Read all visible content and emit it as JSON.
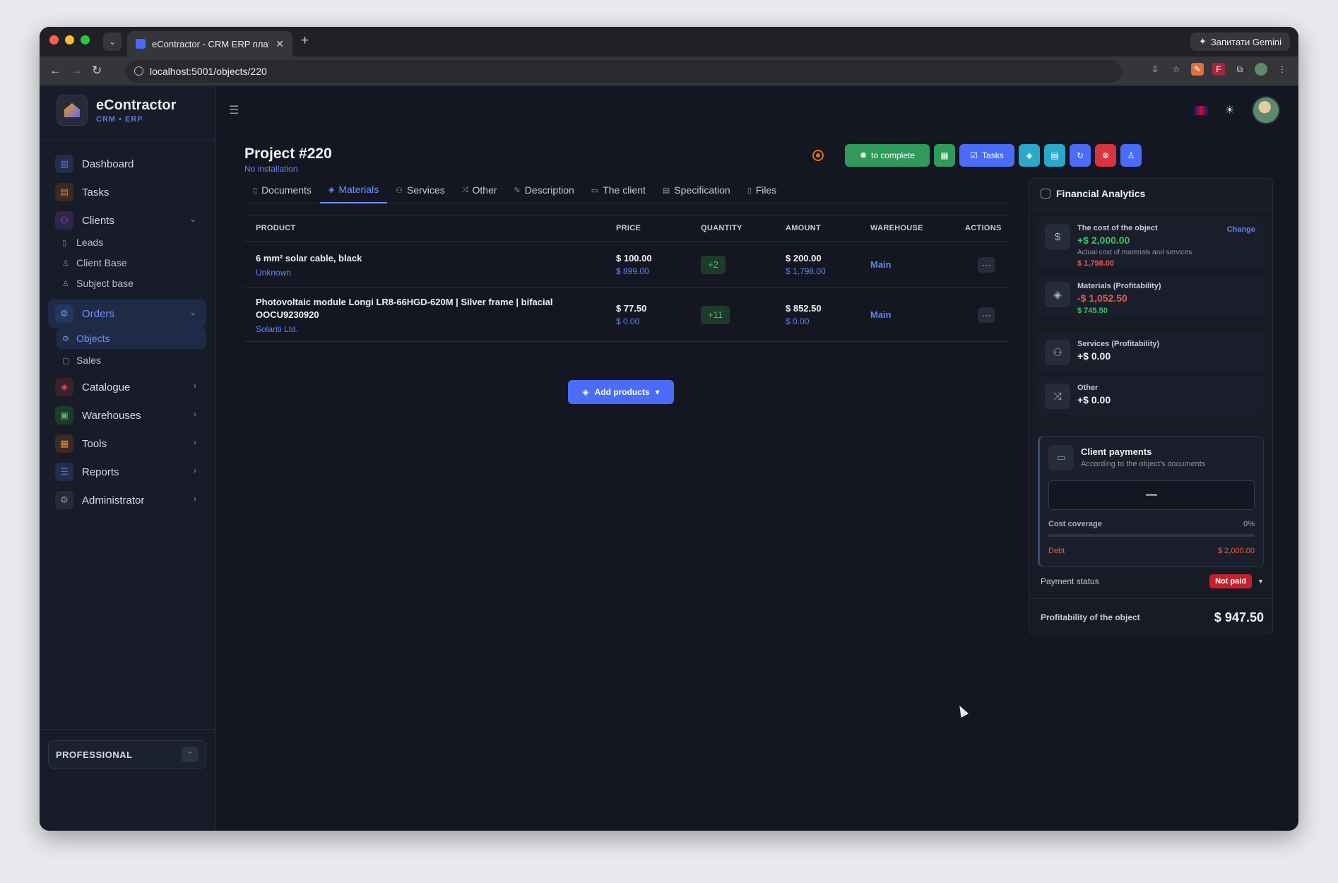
{
  "browser": {
    "tab_title": "eContractor - CRM ERP плат",
    "url": "localhost:5001/objects/220",
    "gemini_label": "Запитати Gemini"
  },
  "sidebar": {
    "brand_name": "eContractor",
    "brand_sub": "CRM • ERP",
    "items": [
      {
        "label": "Dashboard",
        "icon": "chart-bar-icon",
        "color": "#5b6ee0"
      },
      {
        "label": "Tasks",
        "icon": "clipboard-icon",
        "color": "#e0703a"
      },
      {
        "label": "Clients",
        "icon": "users-icon",
        "color": "#a05be0"
      },
      {
        "label": "Leads",
        "icon": "doc-icon"
      },
      {
        "label": "Client Base",
        "icon": "user-icon"
      },
      {
        "label": "Subject base",
        "icon": "user-icon"
      },
      {
        "label": "Orders",
        "icon": "gear-icon",
        "color": "#4a7ae0"
      },
      {
        "label": "Objects",
        "icon": "gear-icon"
      },
      {
        "label": "Sales",
        "icon": "bag-icon"
      },
      {
        "label": "Catalogue",
        "icon": "cube-icon",
        "color": "#e04a5b"
      },
      {
        "label": "Warehouses",
        "icon": "box-icon",
        "color": "#3fbf6a"
      },
      {
        "label": "Tools",
        "icon": "toolbox-icon",
        "color": "#e08a3a"
      },
      {
        "label": "Reports",
        "icon": "report-icon",
        "color": "#5b6ee0"
      },
      {
        "label": "Administrator",
        "icon": "gear-icon",
        "color": "#8b93a7"
      }
    ],
    "plan_label": "PROFESSIONAL"
  },
  "header": {
    "title": "Project #220",
    "subtitle": "No installation",
    "complete_label": "to complete",
    "tasks_label": "Tasks"
  },
  "tabs": [
    "Documents",
    "Materials",
    "Services",
    "Other",
    "Description",
    "The client",
    "Specification",
    "Files"
  ],
  "table": {
    "headers": [
      "PRODUCT",
      "PRICE",
      "QUANTITY",
      "AMOUNT",
      "WAREHOUSE",
      "ACTIONS"
    ],
    "rows": [
      {
        "product": "6 mm² solar cable, black",
        "supplier": "Unknown",
        "price": "$ 100.00",
        "price2": "$ 899.00",
        "qty": "+2",
        "amount": "$ 200.00",
        "amount2": "$ 1,798.00",
        "warehouse": "Main"
      },
      {
        "product": "Photovoltaic module Longi LR8-66HGD-620M | Silver frame | bifacial OOCU9230920",
        "supplier": "Solariti Ltd.",
        "price": "$ 77.50",
        "price2": "$ 0.00",
        "qty": "+11",
        "amount": "$ 852.50",
        "amount2": "$ 0.00",
        "warehouse": "Main"
      }
    ],
    "add_label": "Add products"
  },
  "finance": {
    "title": "Financial Analytics",
    "cost_label": "The cost of the object",
    "cost_value": "+$ 2,000.00",
    "cost_note": "Actual cost of materials and services",
    "cost_actual": "$ 1,798.00",
    "change_label": "Change",
    "materials_label": "Materials (Profitability)",
    "materials_value": "-$ 1,052.50",
    "materials_sub": "$ 745.50",
    "services_label": "Services (Profitability)",
    "services_value": "+$ 0.00",
    "other_label": "Other",
    "other_value": "+$ 0.00",
    "payments_title": "Client payments",
    "payments_sub": "According to the object's documents",
    "payments_value": "—",
    "coverage_label": "Cost coverage",
    "coverage_value": "0%",
    "coverage_fraction": 0,
    "debt_label": "Debt",
    "debt_value": "$ 2,000.00",
    "status_label": "Payment status",
    "status_value": "Not paid",
    "profit_label": "Profitability of the object",
    "profit_value": "$ 947.50"
  }
}
